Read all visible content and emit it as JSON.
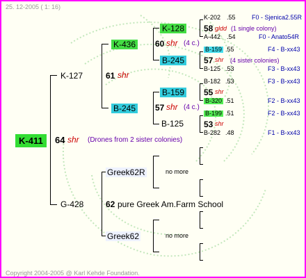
{
  "header": {
    "date": "25. 12-2005 ( 1: 16)"
  },
  "footer": {
    "copyright": "Copyright 2004-2005 @ Karl Kehde Foundation."
  },
  "root": {
    "label": "K-411",
    "number": "64",
    "code": "shr",
    "note": "(Drones from 2 sister colonies)"
  },
  "parents": {
    "top": {
      "label": "K-127",
      "number": "61",
      "code": "shr"
    },
    "bottom": {
      "label": "G-428",
      "number": "62",
      "note": "pure Greek Am.Farm School"
    }
  },
  "grandparents": [
    {
      "label": "K-436",
      "number": "60",
      "code": "shr",
      "count": "(4 c.)"
    },
    {
      "label": "B-245",
      "number": "57",
      "code": "shr",
      "count": "(4 c.)"
    },
    {
      "label": "Greek62R",
      "nomore": "no more"
    },
    {
      "label": "Greek62",
      "nomore": "no more"
    }
  ],
  "ggp": [
    {
      "label": "K-128"
    },
    {
      "label": "B-245"
    },
    {
      "label": "B-159"
    },
    {
      "label": "B-125"
    }
  ],
  "gggp": [
    {
      "label": "K-202",
      "val": ".55",
      "ref": "F0 - Sjenica2.55R"
    },
    {
      "number": "58",
      "code": "gldd",
      "note": "(1 single colony)"
    },
    {
      "label": "A-442",
      "val": ".54",
      "ref": "F0 - Anato54R"
    },
    {
      "label": "B-159",
      "val": ".55",
      "ref": "F4 - B-xx43"
    },
    {
      "number": "57",
      "code": "shr",
      "note": "(4 sister colonies)"
    },
    {
      "label": "B-125",
      "val": ".53",
      "ref": "F3 - B-xx43"
    },
    {
      "label": "B-182",
      "val": ".53",
      "ref": "F3 - B-xx43"
    },
    {
      "number": "55",
      "code": "shr"
    },
    {
      "label": "B-320",
      "val": ".51",
      "ref": "F2 - B-xx43"
    },
    {
      "label": "B-199",
      "val": ".51",
      "ref": "F2 - B-xx43"
    },
    {
      "number": "53",
      "code": "shr"
    },
    {
      "label": "B-282",
      "val": ".48",
      "ref": "F1 - B-xx43"
    }
  ]
}
